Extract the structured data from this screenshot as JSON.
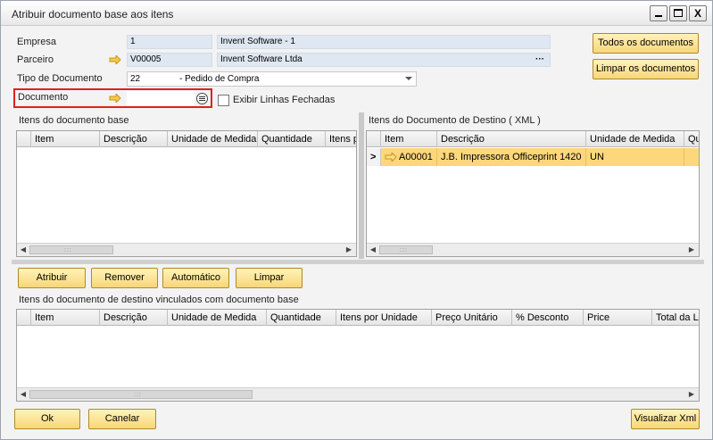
{
  "window": {
    "title": "Atribuir documento base aos itens",
    "min_glyph": "_",
    "max_glyph": "□",
    "close_glyph": "X"
  },
  "header": {
    "empresa_label": "Empresa",
    "empresa_code": "1",
    "empresa_name": "Invent Software - 1",
    "parceiro_label": "Parceiro",
    "parceiro_code": "V00005",
    "parceiro_name": "Invent Software Ltda",
    "parceiro_more": "···",
    "tipo_label": "Tipo de Documento",
    "tipo_code": "22",
    "tipo_value": "- Pedido de Compra",
    "documento_label": "Documento",
    "documento_value": "",
    "exibir_label": "Exibir Linhas Fechadas",
    "todos_btn": "Todos os documentos",
    "limpar_docs_btn": "Limpar os documentos"
  },
  "base_grid": {
    "title": "Itens do documento base",
    "columns": [
      "",
      "Item",
      "Descrição",
      "Unidade de Medida",
      "Quantidade",
      "Itens p"
    ],
    "grip": ":::"
  },
  "dest_grid": {
    "title": "Itens do Documento de Destino ( XML )",
    "columns": [
      "",
      "Item",
      "Descrição",
      "Unidade de Medida",
      "Qu"
    ],
    "rows": [
      {
        "marker": ">",
        "item": "A00001",
        "descricao": "J.B. Impressora Officeprint 1420",
        "unidade": "UN"
      }
    ],
    "grip": ":::"
  },
  "actions": {
    "atribuir": "Atribuir",
    "remover": "Remover",
    "automatico": "Automático",
    "limpar": "Limpar"
  },
  "linked_grid": {
    "title": "Itens do documento de destino vinculados com documento base",
    "columns": [
      "",
      "Item",
      "Descrição",
      "Unidade de Medida",
      "Quantidade",
      "Itens por Unidade",
      "Preço Unitário",
      "% Desconto",
      "Price",
      "Total da L"
    ],
    "grip": ":::"
  },
  "footer": {
    "ok": "Ok",
    "cancelar": "Canelar",
    "visualizar": "Visualizar Xml"
  },
  "colors": {
    "accent_button": "#f8d67a",
    "selected_row": "#fcd77b",
    "field_bg": "#dfe8f2",
    "highlight_border": "#e02020"
  }
}
